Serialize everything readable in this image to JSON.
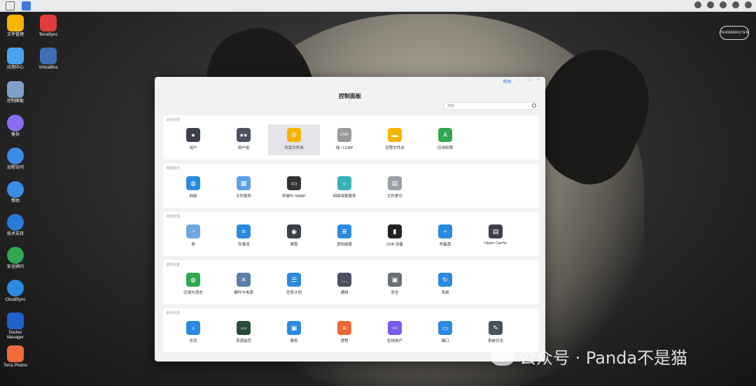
{
  "desktop": {
    "icons": [
      {
        "label": "文件管理",
        "icon": "folder-icon",
        "color": "#f5b400"
      },
      {
        "label": "TerraSync",
        "icon": "terrasync-icon",
        "color": "#e23b3b"
      },
      {
        "label": "应用中心",
        "icon": "app-center-icon",
        "color": "#4aa3f0"
      },
      {
        "label": "VirtualBox",
        "icon": "virtualbox-icon",
        "color": "#3e6eb5"
      },
      {
        "label": "控制面板",
        "icon": "control-panel-icon",
        "color": "#7da1c7"
      },
      {
        "label": "备份",
        "icon": "backup-icon",
        "color": "#8a6cf0"
      },
      {
        "label": "远程访问",
        "icon": "remote-access-icon",
        "color": "#3c8ce7"
      },
      {
        "label": "帮助",
        "icon": "help-icon",
        "color": "#3c8ce7"
      },
      {
        "label": "技术支持",
        "icon": "support-icon",
        "color": "#2a7ad6"
      },
      {
        "label": "安全顾问",
        "icon": "security-icon",
        "color": "#2fa84f"
      },
      {
        "label": "CloudSync",
        "icon": "cloudsync-icon",
        "color": "#2a8ae0"
      },
      {
        "label": "Docker Manager",
        "icon": "docker-icon",
        "color": "#1d63c9"
      },
      {
        "label": "Terra Photos",
        "icon": "photos-icon",
        "color": "#f06a3a"
      }
    ]
  },
  "logo": {
    "text": "TERRAMASTER"
  },
  "window": {
    "title": "控制面板",
    "controls": {
      "help": "帮助",
      "minimize": "–",
      "maximize": "□",
      "close": "×"
    },
    "search_placeholder": "搜索",
    "sections": [
      {
        "title": "访问权限",
        "items": [
          {
            "label": "用户",
            "icon": "user-icon",
            "color": "#3a3f4a",
            "glyph": "●"
          },
          {
            "label": "用户组",
            "icon": "user-group-icon",
            "color": "#4a5060",
            "glyph": "●●"
          },
          {
            "label": "共享文件夹",
            "icon": "shared-folder-icon",
            "color": "#f5b400",
            "glyph": "⚙"
          },
          {
            "label": "域 / LDAP",
            "icon": "ldap-icon",
            "color": "#9a9a9a",
            "glyph": "LDAP"
          },
          {
            "label": "远程文件夹",
            "icon": "remote-folder-icon",
            "color": "#f5b400",
            "glyph": "▬"
          },
          {
            "label": "应用权限",
            "icon": "app-privilege-icon",
            "color": "#2fa84f",
            "glyph": "A"
          }
        ]
      },
      {
        "title": "网络服务",
        "items": [
          {
            "label": "网络",
            "icon": "network-globe-icon",
            "color": "#2a8ae0",
            "glyph": "◍"
          },
          {
            "label": "文件服务",
            "icon": "file-service-icon",
            "color": "#5aa0e6",
            "glyph": "▦"
          },
          {
            "label": "终端与 SNMP",
            "icon": "terminal-icon",
            "color": "#333333",
            "glyph": "▭"
          },
          {
            "label": "网络探索服务",
            "icon": "network-discovery-icon",
            "color": "#3ab0b8",
            "glyph": "⌕"
          },
          {
            "label": "文件索引",
            "icon": "file-index-icon",
            "color": "#9aa0a8",
            "glyph": "▤"
          }
        ]
      },
      {
        "title": "存储管理",
        "items": [
          {
            "label": "卷",
            "icon": "volume-pie-icon",
            "color": "#6fa8dc",
            "glyph": "◔"
          },
          {
            "label": "存储池",
            "icon": "storage-pool-icon",
            "color": "#2a8ae0",
            "glyph": "≡"
          },
          {
            "label": "硬盘",
            "icon": "hard-disk-icon",
            "color": "#3a3f4a",
            "glyph": "◉"
          },
          {
            "label": "虚拟磁盘",
            "icon": "virtual-disk-icon",
            "color": "#2a8ae0",
            "glyph": "≣"
          },
          {
            "label": "USB 设备",
            "icon": "usb-icon",
            "color": "#222222",
            "glyph": "▮"
          },
          {
            "label": "热备盘",
            "icon": "hot-spare-icon",
            "color": "#2a8ae0",
            "glyph": "+"
          },
          {
            "label": "Hyper Cache",
            "icon": "hyper-cache-icon",
            "color": "#3a3f4a",
            "glyph": "▤"
          }
        ]
      },
      {
        "title": "通用设置",
        "items": [
          {
            "label": "区域与语言",
            "icon": "region-globe-icon",
            "color": "#2fa84f",
            "glyph": "◍"
          },
          {
            "label": "硬件与电源",
            "icon": "hardware-tools-icon",
            "color": "#5a7fa8",
            "glyph": "✕"
          },
          {
            "label": "任务计划",
            "icon": "task-schedule-icon",
            "color": "#2a8ae0",
            "glyph": "☰"
          },
          {
            "label": "通知",
            "icon": "notification-chat-icon",
            "color": "#4a5060",
            "glyph": "…"
          },
          {
            "label": "安全",
            "icon": "security-lock-icon",
            "color": "#6a6f78",
            "glyph": "▣"
          },
          {
            "label": "系统",
            "icon": "system-update-icon",
            "color": "#2a8ae0",
            "glyph": "↻"
          }
        ]
      },
      {
        "title": "系统资源",
        "items": [
          {
            "label": "总览",
            "icon": "overview-icon",
            "color": "#2a8ae0",
            "glyph": "i"
          },
          {
            "label": "资源监控",
            "icon": "resource-monitor-icon",
            "color": "#2a4a3a",
            "glyph": "〰"
          },
          {
            "label": "服务",
            "icon": "service-icon",
            "color": "#2a8ae0",
            "glyph": "▣"
          },
          {
            "label": "进程",
            "icon": "process-icon",
            "color": "#e86a3a",
            "glyph": "≡"
          },
          {
            "label": "在线用户",
            "icon": "online-user-icon",
            "color": "#7a5af0",
            "glyph": "⇦"
          },
          {
            "label": "端口",
            "icon": "port-icon",
            "color": "#2a8ae0",
            "glyph": "▭"
          },
          {
            "label": "系统日志",
            "icon": "system-log-icon",
            "color": "#4a5060",
            "glyph": "✎"
          }
        ]
      }
    ]
  },
  "watermark": {
    "text": "公众号 · Panda不是猫"
  }
}
